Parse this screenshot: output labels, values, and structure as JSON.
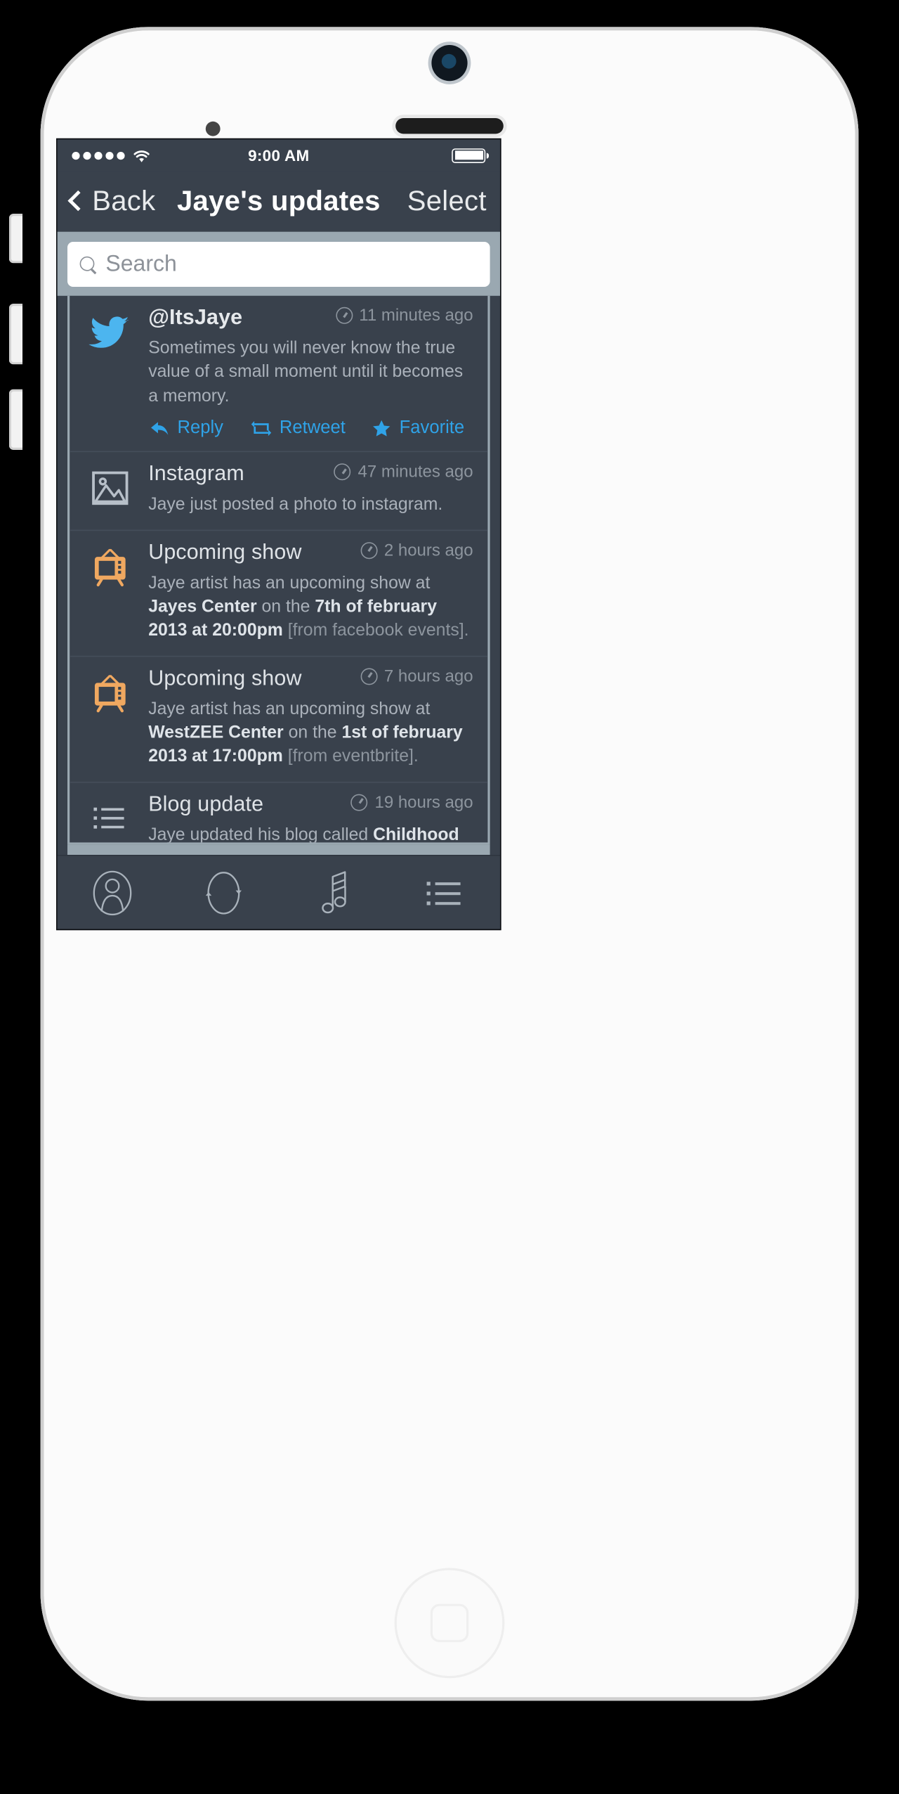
{
  "device": {
    "type": "iphone-5s-white"
  },
  "status_bar": {
    "signal_dots": 5,
    "wifi_icon": "wifi-icon",
    "time": "9:00 AM",
    "battery_icon": "battery-full-icon"
  },
  "nav_bar": {
    "back_icon": "chevron-left-icon",
    "back_label": "Back",
    "title": "Jaye's updates",
    "select_label": "Select"
  },
  "search": {
    "icon": "search-icon",
    "placeholder": "Search",
    "value": ""
  },
  "feed": {
    "items": [
      {
        "icon": "twitter-bird-icon",
        "icon_color": "#4cb5ef",
        "title": "@ItsJaye",
        "time": "11 minutes ago",
        "time_icon": "clock-icon",
        "body_lead": "Sometimes you will never know the true value of a small moment until it becomes a memory.",
        "body_bold": "",
        "body_mid": "",
        "body_tail": "",
        "actions": [
          {
            "icon": "reply-arrow-icon",
            "label": "Reply"
          },
          {
            "icon": "retweet-icon",
            "label": "Retweet"
          },
          {
            "icon": "star-icon",
            "label": "Favorite"
          }
        ]
      },
      {
        "icon": "photo-icon",
        "icon_color": "#b7bfc8",
        "title": "Instagram",
        "time": "47 minutes ago",
        "time_icon": "clock-icon",
        "body_lead": "Jaye just posted a photo to instagram.",
        "body_bold": "",
        "body_mid": "",
        "body_tail": "",
        "actions": []
      },
      {
        "icon": "tv-icon",
        "icon_color": "#f0a860",
        "title": "Upcoming show",
        "time": "2 hours ago",
        "time_icon": "clock-icon",
        "body_lead": "Jaye artist has an upcoming show at ",
        "body_bold": "Jayes Center",
        "body_mid": " on the ",
        "body_bold2": "7th of february 2013 at 20:00pm",
        "body_tail": " [from facebook events].",
        "actions": []
      },
      {
        "icon": "tv-icon",
        "icon_color": "#f0a860",
        "title": "Upcoming show",
        "time": "7 hours ago",
        "time_icon": "clock-icon",
        "body_lead": "Jaye artist has an upcoming show at ",
        "body_bold": "WestZEE Center",
        "body_mid": " on the ",
        "body_bold2": "1st of february 2013 at 17:00pm",
        "body_tail": " [from eventbrite].",
        "actions": []
      },
      {
        "icon": "list-icon",
        "icon_color": "#b7bfc8",
        "title": "Blog update",
        "time": "19 hours ago",
        "time_icon": "clock-icon",
        "body_lead": "Jaye updated his blog called ",
        "body_bold": "Childhood",
        "body_mid": "",
        "body_bold2": "",
        "body_tail": "",
        "actions": []
      }
    ]
  },
  "tab_bar": {
    "items": [
      {
        "icon": "profile-icon"
      },
      {
        "icon": "sync-icon"
      },
      {
        "icon": "music-note-icon"
      },
      {
        "icon": "list-icon"
      }
    ]
  },
  "colors": {
    "screen_bg": "#39414c",
    "chrome": "#9aa8b1",
    "accent_blue": "#2fa3e8",
    "accent_orange": "#f0a860",
    "twitter_blue": "#4cb5ef",
    "muted_text": "#8d959e"
  }
}
